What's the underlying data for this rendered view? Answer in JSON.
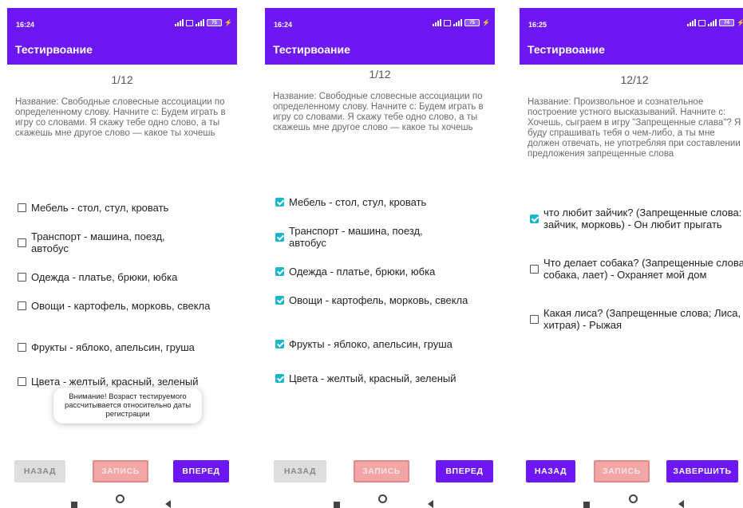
{
  "status": {
    "time1": "16:24",
    "time2": "16:24",
    "time3": "16:25",
    "battery1": "75",
    "battery2": "75",
    "battery3": "74"
  },
  "app_title": "Тестирвоание",
  "screens": [
    {
      "counter": "1/12",
      "description": "Название: Свободные словесные ассоциации по определенному слову. Начните с: Будем играть в игру со словами. Я скажу тебе одно слово, а ты скажешь мне другое слово — какое ты хочешь",
      "options": [
        {
          "text": "Мебель - стол, стул, кровать",
          "checked": false
        },
        {
          "text": "Транспорт - машина, поезд, автобус",
          "checked": false
        },
        {
          "text": "Одежда - платье, брюки, юбка",
          "checked": false
        },
        {
          "text": "Овощи - картофель, морковь, свекла",
          "checked": false
        },
        {
          "text": "Фрукты - яблоко, апельсин, груша",
          "checked": false
        },
        {
          "text": "Цвета - желтый, красный, зеленый",
          "checked": false
        }
      ],
      "toast": "Внимание! Возраст тестируемого рассчитывается относительно даты регистрации",
      "buttons": {
        "back": "НАЗАД",
        "record": "ЗАПИСЬ",
        "next": "ВПЕРЕД"
      }
    },
    {
      "counter": "1/12",
      "description": "Название: Свободные словесные ассоциации по определенному слову. Начните с: Будем играть в игру со словами. Я скажу тебе одно слово, а ты скажешь мне другое слово — какое ты хочешь",
      "options": [
        {
          "text": "Мебель - стол, стул, кровать",
          "checked": true
        },
        {
          "text": "Транспорт - машина, поезд, автобус",
          "checked": true
        },
        {
          "text": "Одежда - платье, брюки, юбка",
          "checked": true
        },
        {
          "text": "Овощи - картофель, морковь, свекла",
          "checked": true
        },
        {
          "text": "Фрукты - яблоко, апельсин, груша",
          "checked": true
        },
        {
          "text": "Цвета - желтый, красный, зеленый",
          "checked": true
        }
      ],
      "buttons": {
        "back": "НАЗАД",
        "record": "ЗАПИСЬ",
        "next": "ВПЕРЕД"
      }
    },
    {
      "counter": "12/12",
      "description": "Название: Произвольное и сознательное построение устного высказываний. Начните с: Хочешь, сыграем в игру \"Запрещенные слава\"? Я буду спрашивать тебя о чем-либо, а ты мне должен отвечать, не употребляя при составлении предложения запрещенные слова",
      "options": [
        {
          "text": "что любит зайчик? (Запрещенные слова: зайчик, морковь) - Он любит прыгать",
          "checked": true
        },
        {
          "text": "Что делает собака? (Запрещенные слова: собака, лает) - Охраняет мой дом",
          "checked": false
        },
        {
          "text": "Какая лиса? (Запрещенные слова; Лиса, хитрая) - Рыжая",
          "checked": false
        }
      ],
      "buttons": {
        "back": "НАЗАД",
        "record": "ЗАПИСЬ",
        "finish": "ЗАВЕРШИТЬ"
      }
    }
  ],
  "colors": {
    "primary": "#6d17f5",
    "checkbox": "#16b7cc",
    "record": "#f3a6a6",
    "disabled": "#dedede"
  }
}
